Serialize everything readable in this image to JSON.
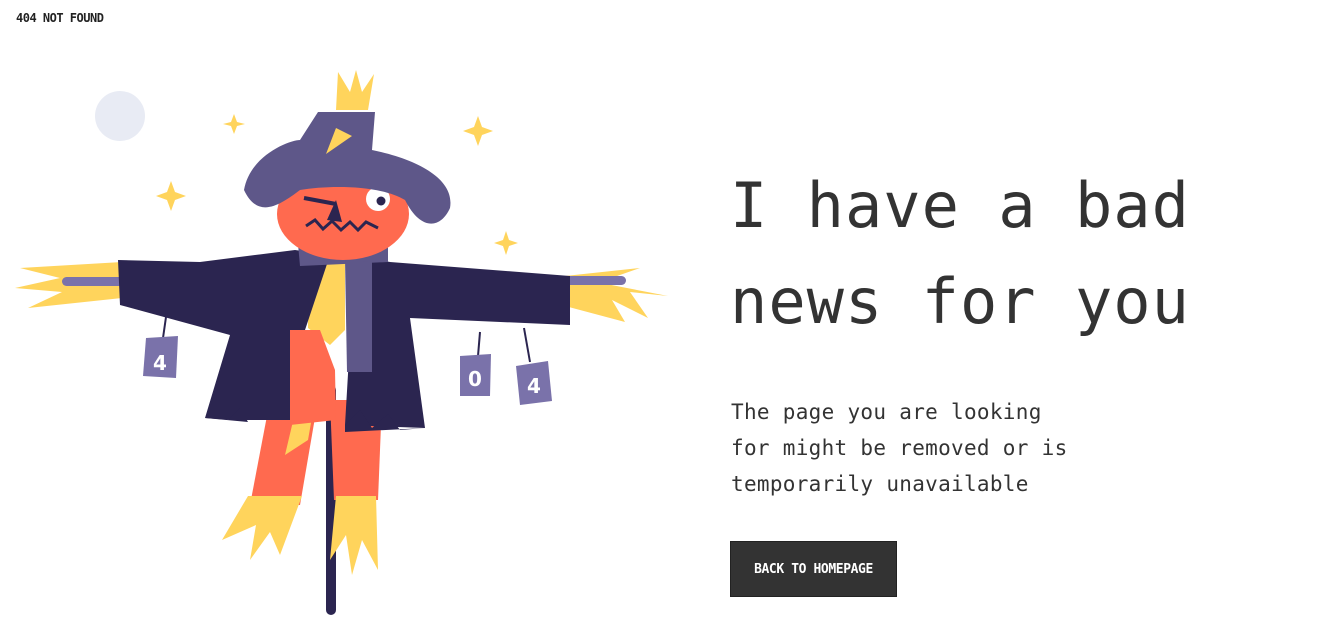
{
  "header": {
    "brand": "404 NOT FOUND"
  },
  "main": {
    "headline_line1": "I have a bad",
    "headline_line2": "news for you",
    "description_line1": "The page you are looking",
    "description_line2": "for might be removed or is",
    "description_line3": "temporarily unavailable",
    "button_label": "BACK TO HOMEPAGE"
  },
  "illustration": {
    "cans": [
      "4",
      "0",
      "4"
    ]
  },
  "colors": {
    "text": "#333333",
    "button_bg": "#333333",
    "button_text": "#ffffff",
    "hat": "#5e5789",
    "coat": "#2b2550",
    "pumpkin": "#ff6a4f",
    "straw": "#ffd45c",
    "can": "#7a72aa",
    "moon": "#e8ebf4"
  }
}
